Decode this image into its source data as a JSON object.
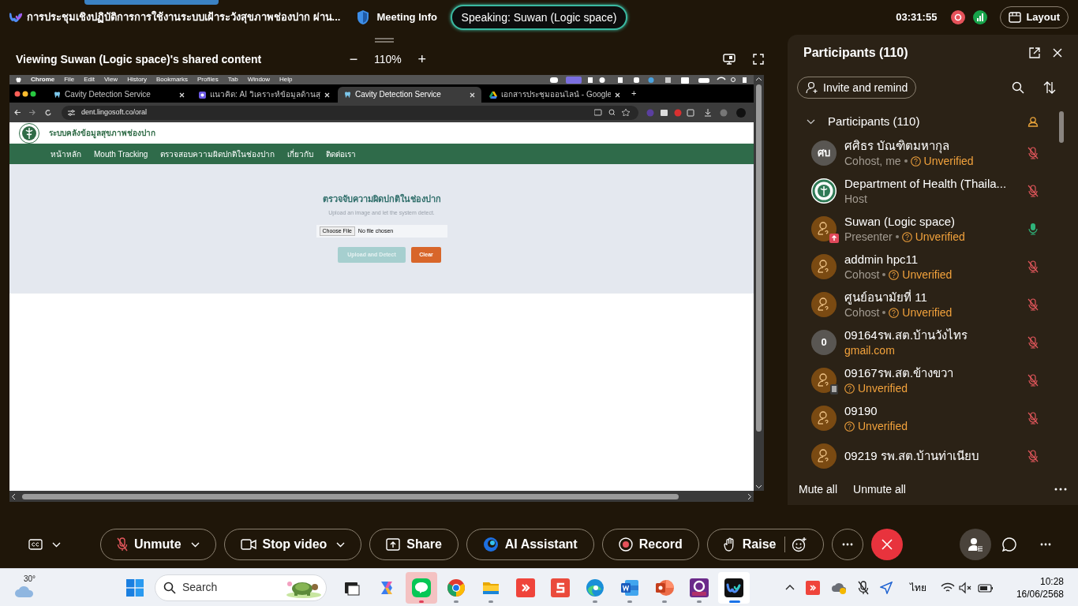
{
  "meeting": {
    "title": "การประชุมเชิงปฏิบัติการการใช้งานระบบเฝ้าระวังสุขภาพช่องปาก ผ่าน...",
    "info_label": "Meeting Info",
    "speaking": "Speaking: Suwan (Logic space)",
    "elapsed": "03:31:55",
    "layout_label": "Layout"
  },
  "share": {
    "viewing": "Viewing Suwan (Logic space)'s shared content",
    "zoom_out": "−",
    "zoom": "110%",
    "zoom_in": "+"
  },
  "remote": {
    "menubar": [
      "Chrome",
      "File",
      "Edit",
      "View",
      "History",
      "Bookmarks",
      "Profiles",
      "Tab",
      "Window",
      "Help"
    ],
    "tabs": [
      {
        "title": "Cavity Detection Service",
        "kind": "tooth",
        "selected": false
      },
      {
        "title": "แนวคิด: AI วิเคราะห์ข้อมูลด้านสุ",
        "kind": "app",
        "selected": false
      },
      {
        "title": "Cavity Detection Service",
        "kind": "tooth",
        "selected": true
      },
      {
        "title": "เอกสารประชุมออนไลน์ - Google",
        "kind": "drive",
        "selected": false
      }
    ],
    "new_tab": "+",
    "url": "dent.lingosoft.co/oral",
    "site": {
      "title": "ระบบคลังข้อมูลสุขภาพช่องปาก",
      "nav": [
        "หน้าหลัก",
        "Mouth Tracking",
        "ตรวจสอบความผิดปกติในช่องปาก",
        "เกี่ยวกับ",
        "ติดต่อเรา"
      ],
      "heading": "ตรวจจับความผิดปกติในช่องปาก",
      "subheading": "Upload an image and let the system detect.",
      "file_button": "Choose File",
      "file_status": "No file chosen",
      "buttons": [
        {
          "label": "Upload and Detect",
          "kind": "primary",
          "disabled": true
        },
        {
          "label": "Clear",
          "kind": "danger",
          "disabled": false
        }
      ]
    }
  },
  "panel": {
    "title": "Participants (110)",
    "invite": "Invite and remind",
    "section": {
      "label": "Participants (110)",
      "expanded": true
    },
    "participants": [
      {
        "name": "ศศิธร บัณฑิตมหากุล",
        "avatar": {
          "kind": "initials",
          "text": "ศบ"
        },
        "role": "Cohost, me",
        "detail": {
          "kind": "unverified",
          "text": "Unverified"
        },
        "muted": true
      },
      {
        "name": "Department of Health (Thaila...",
        "avatar": {
          "kind": "emblem"
        },
        "role": "Host",
        "muted": true
      },
      {
        "name": "Suwan (Logic space)",
        "avatar": {
          "kind": "guest"
        },
        "badge": {
          "kind": "presenter"
        },
        "role": "Presenter",
        "detail": {
          "kind": "unverified",
          "text": "Unverified"
        },
        "muted": false
      },
      {
        "name": "addmin hpc11",
        "avatar": {
          "kind": "guest"
        },
        "role": "Cohost",
        "detail": {
          "kind": "unverified",
          "text": "Unverified"
        },
        "muted": true
      },
      {
        "name": "ศูนย์อนามัยที่ 11",
        "avatar": {
          "kind": "guest"
        },
        "role": "Cohost",
        "detail": {
          "kind": "unverified",
          "text": "Unverified"
        },
        "muted": true
      },
      {
        "name": "09164รพ.สต.บ้านวังไทร",
        "avatar": {
          "kind": "initials",
          "text": "0"
        },
        "detail": {
          "kind": "domain",
          "text": "gmail.com"
        },
        "muted": true
      },
      {
        "name": "09167รพ.สต.ข้างขวา",
        "avatar": {
          "kind": "guest"
        },
        "badge": {
          "kind": "mobile"
        },
        "detail": {
          "kind": "unverified",
          "text": "Unverified"
        },
        "muted": true
      },
      {
        "name": "09190",
        "avatar": {
          "kind": "guest"
        },
        "detail": {
          "kind": "unverified",
          "text": "Unverified"
        },
        "muted": true
      },
      {
        "name": "09219 รพ.สต.บ้านท่าเนียบ",
        "avatar": {
          "kind": "guest"
        },
        "muted": true
      }
    ],
    "footer": [
      "Mute all",
      "Unmute all"
    ]
  },
  "controls": [
    {
      "label": "Unmute",
      "kind": "mic-off",
      "caret": true
    },
    {
      "label": "Stop video",
      "kind": "video",
      "caret": true
    },
    {
      "label": "Share",
      "kind": "share",
      "caret": false
    },
    {
      "label": "AI Assistant",
      "kind": "ai",
      "caret": false
    },
    {
      "label": "Record",
      "kind": "record",
      "caret": false
    },
    {
      "label": "Raise",
      "kind": "hand",
      "caret": false,
      "reaction": true
    }
  ],
  "taskbar": {
    "weather": "30°",
    "search_placeholder": "Search",
    "apps": [
      {
        "kind": "terminal",
        "running": false,
        "selected": false
      },
      {
        "kind": "copilot",
        "running": false,
        "selected": false
      },
      {
        "kind": "chat",
        "running": true,
        "selected": false,
        "flashing": true
      },
      {
        "kind": "chrome",
        "running": true,
        "selected": false
      },
      {
        "kind": "folder",
        "running": true,
        "selected": false
      },
      {
        "kind": "remote",
        "running": false,
        "selected": false
      },
      {
        "kind": "sapp",
        "running": false,
        "selected": false
      },
      {
        "kind": "edge",
        "running": true,
        "selected": false
      },
      {
        "kind": "word",
        "running": true,
        "selected": false
      },
      {
        "kind": "slides",
        "running": true,
        "selected": false
      },
      {
        "kind": "pdf",
        "running": true,
        "selected": false
      },
      {
        "kind": "meeting",
        "running": true,
        "selected": true
      }
    ],
    "language": "ไทย",
    "time": "10:28",
    "date": "16/06/2568"
  }
}
